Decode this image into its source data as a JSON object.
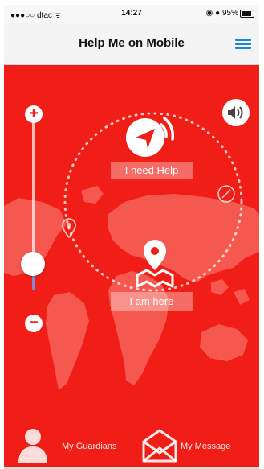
{
  "status_bar": {
    "carrier": "●●●○○ dtac ᯤ",
    "time": "14:27",
    "battery": "◉ ● 95%"
  },
  "nav": {
    "title": "Help Me on Mobile",
    "menu_icon": "hamburger-menu-icon"
  },
  "main": {
    "need_help_label": "I need Help",
    "i_am_here_label": "I am here",
    "zoom_in_symbol": "+",
    "zoom_out_symbol": "−",
    "zoom_level": 0.35,
    "sound_icon": "speaker-icon"
  },
  "bottom_nav": {
    "guardians_label": "My Guardians",
    "message_label": "My Message"
  },
  "colors": {
    "primary_red": "#f01e16",
    "accent_blue": "#1a86d8",
    "white": "#ffffff"
  }
}
